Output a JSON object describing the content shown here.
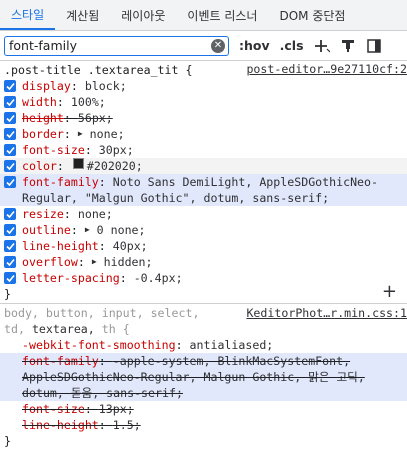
{
  "tabs": [
    {
      "label": "스타일"
    },
    {
      "label": "계산됨"
    },
    {
      "label": "레이아웃"
    },
    {
      "label": "이벤트 리스너"
    },
    {
      "label": "DOM 중단점"
    }
  ],
  "toolbar": {
    "filter_value": "font-family",
    "hov_label": ":hov",
    "cls_label": ".cls"
  },
  "rule1": {
    "selector": ".post-title .textarea_tit {",
    "source": "post-editor…9e27110cf:2",
    "props": [
      {
        "name": "display",
        "value": "block;"
      },
      {
        "name": "width",
        "value": "100%;"
      },
      {
        "name": "height",
        "value": "56px;"
      },
      {
        "name": "border",
        "value": "none;"
      },
      {
        "name": "font-size",
        "value": "30px;"
      },
      {
        "name": "color",
        "value": "#202020;"
      },
      {
        "name": "font-family",
        "value": "Noto Sans DemiLight, AppleSDGothicNeo-Regular, \"Malgun Gothic\", dotum, sans-serif;"
      },
      {
        "name": "resize",
        "value": "none;"
      },
      {
        "name": "outline",
        "value": "0 none;"
      },
      {
        "name": "line-height",
        "value": "40px;"
      },
      {
        "name": "overflow",
        "value": "hidden;"
      },
      {
        "name": "letter-spacing",
        "value": "-0.4px;"
      }
    ],
    "close": "}"
  },
  "rule2": {
    "selector_dim": "body, button, input, select,",
    "selector_dim2": "td,",
    "selector_match": "textarea,",
    "selector_dim3": "th {",
    "source": "KeditorPhot…r.min.css:1",
    "props": [
      {
        "name": "-webkit-font-smoothing",
        "value": "antialiased;"
      },
      {
        "name": "font-family",
        "value": "-apple-system, BlinkMacSystemFont, AppleSDGothicNeo-Regular, Malgun Gothic, 맑은 고딕, dotum, 돋움, sans-serif;"
      },
      {
        "name": "font-size",
        "value": "13px;"
      },
      {
        "name": "line-height",
        "value": "1.5;"
      }
    ],
    "close": "}"
  }
}
